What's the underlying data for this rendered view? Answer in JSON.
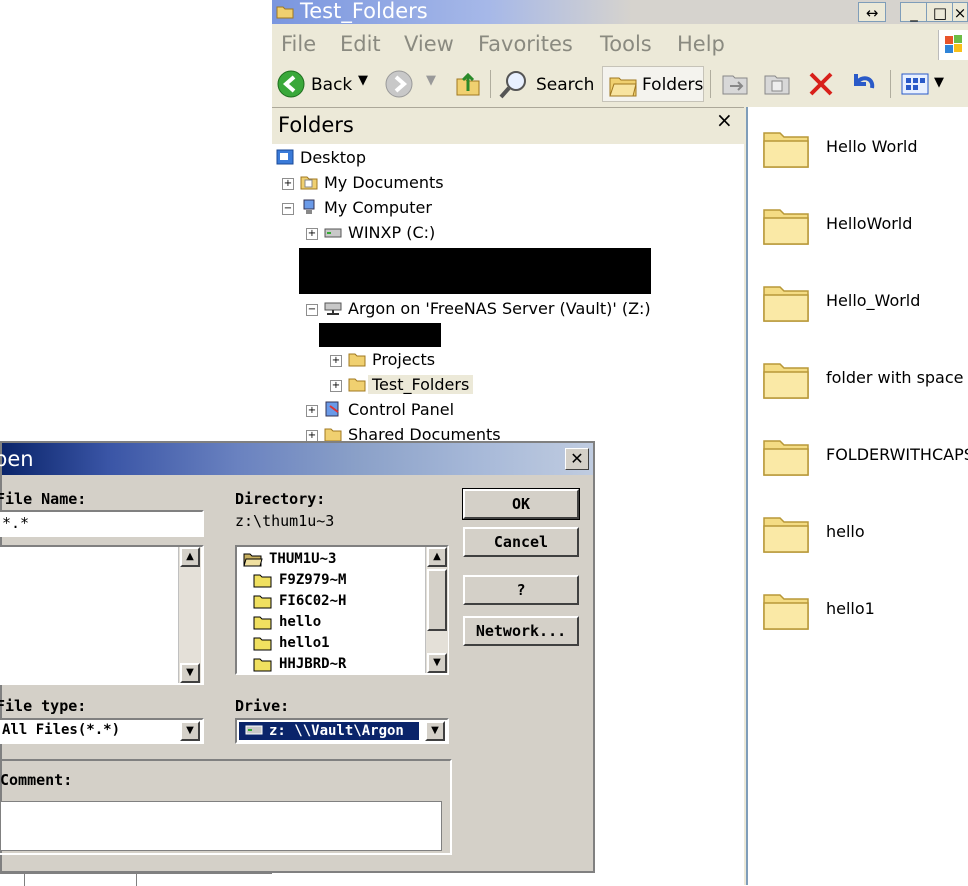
{
  "explorer": {
    "title": "Test_Folders",
    "menu": [
      "File",
      "Edit",
      "View",
      "Favorites",
      "Tools",
      "Help"
    ],
    "toolbar": {
      "back": "Back",
      "search": "Search",
      "folders": "Folders"
    },
    "folders_pane": {
      "title": "Folders",
      "close": "×",
      "tree": [
        {
          "label": "Desktop",
          "expander": ""
        },
        {
          "label": "My Documents",
          "expander": "+"
        },
        {
          "label": "My Computer",
          "expander": "−"
        },
        {
          "label": "WINXP (C:)",
          "expander": "+"
        },
        {
          "label": "Argon on 'FreeNAS Server (Vault)' (Z:)",
          "expander": "−"
        },
        {
          "label": "Projects",
          "expander": "+"
        },
        {
          "label": "Test_Folders",
          "expander": "+",
          "selected": true
        },
        {
          "label": "Control Panel",
          "expander": "+"
        },
        {
          "label": "Shared Documents",
          "expander": "+"
        }
      ]
    },
    "files": [
      "Hello World",
      "HelloWorld",
      "Hello_World",
      "folder with space",
      "FOLDERWITHCAPS",
      "hello",
      "hello1"
    ]
  },
  "dialog": {
    "title": "pen",
    "close": "✕",
    "file_name_label": "File Name:",
    "file_name_value": "*.*",
    "directory_label": "Directory:",
    "directory_value": "z:\\thum1u~3",
    "dir_list": [
      "THUM1U~3",
      "F9Z979~M",
      "FI6C02~H",
      "hello",
      "hello1",
      "HHJBRD~R"
    ],
    "file_type_label": "File type:",
    "file_type_value": "All Files(*.*)",
    "drive_label": "Drive:",
    "drive_value": "z: \\\\Vault\\Argon",
    "comment_label": "Comment:",
    "buttons": {
      "ok": "OK",
      "cancel": "Cancel",
      "help": "?",
      "network": "Network..."
    }
  },
  "colors": {
    "folder_yellow": "#f4dc84",
    "selection": "#ece9d8",
    "dialog_face": "#d4d0c8"
  }
}
